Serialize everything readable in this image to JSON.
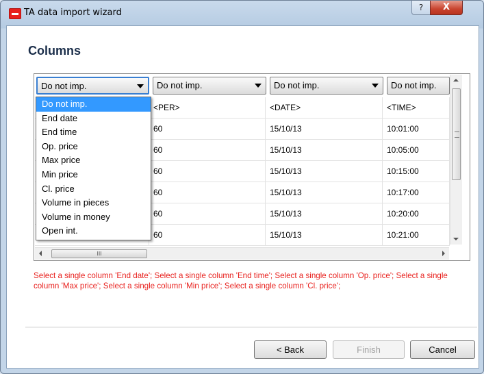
{
  "window": {
    "title": "TA data import wizard",
    "help_glyph": "?",
    "close_glyph": "X"
  },
  "page": {
    "heading": "Columns"
  },
  "grid": {
    "headers": [
      "Do not imp.",
      "Do not imp.",
      "Do not imp.",
      "Do not imp."
    ],
    "rows": [
      [
        "<PER>",
        "<DATE>",
        "<TIME>"
      ],
      [
        "60",
        "15/10/13",
        "10:01:00"
      ],
      [
        "60",
        "15/10/13",
        "10:05:00"
      ],
      [
        "60",
        "15/10/13",
        "10:15:00"
      ],
      [
        "60",
        "15/10/13",
        "10:17:00"
      ],
      [
        "60",
        "15/10/13",
        "10:20:00"
      ],
      [
        "60",
        "15/10/13",
        "10:21:00"
      ]
    ],
    "hscroll_glyph": "III"
  },
  "dropdown": {
    "items": [
      "Do not imp.",
      "End date",
      "End time",
      "Op. price",
      "Max price",
      "Min price",
      "Cl. price",
      "Volume in pieces",
      "Volume in money",
      "Open int."
    ],
    "selected_index": 0
  },
  "validation_message": "Select a single column 'End date'; Select a single column 'End time'; Select a single column 'Op. price'; Select a single column 'Max price'; Select a single column 'Min price'; Select a single column 'Cl. price';",
  "buttons": {
    "back": "< Back",
    "finish": "Finish",
    "cancel": "Cancel"
  },
  "colors": {
    "error": "#e8201d",
    "selection": "#3399ff",
    "brand": "#e8201d"
  }
}
